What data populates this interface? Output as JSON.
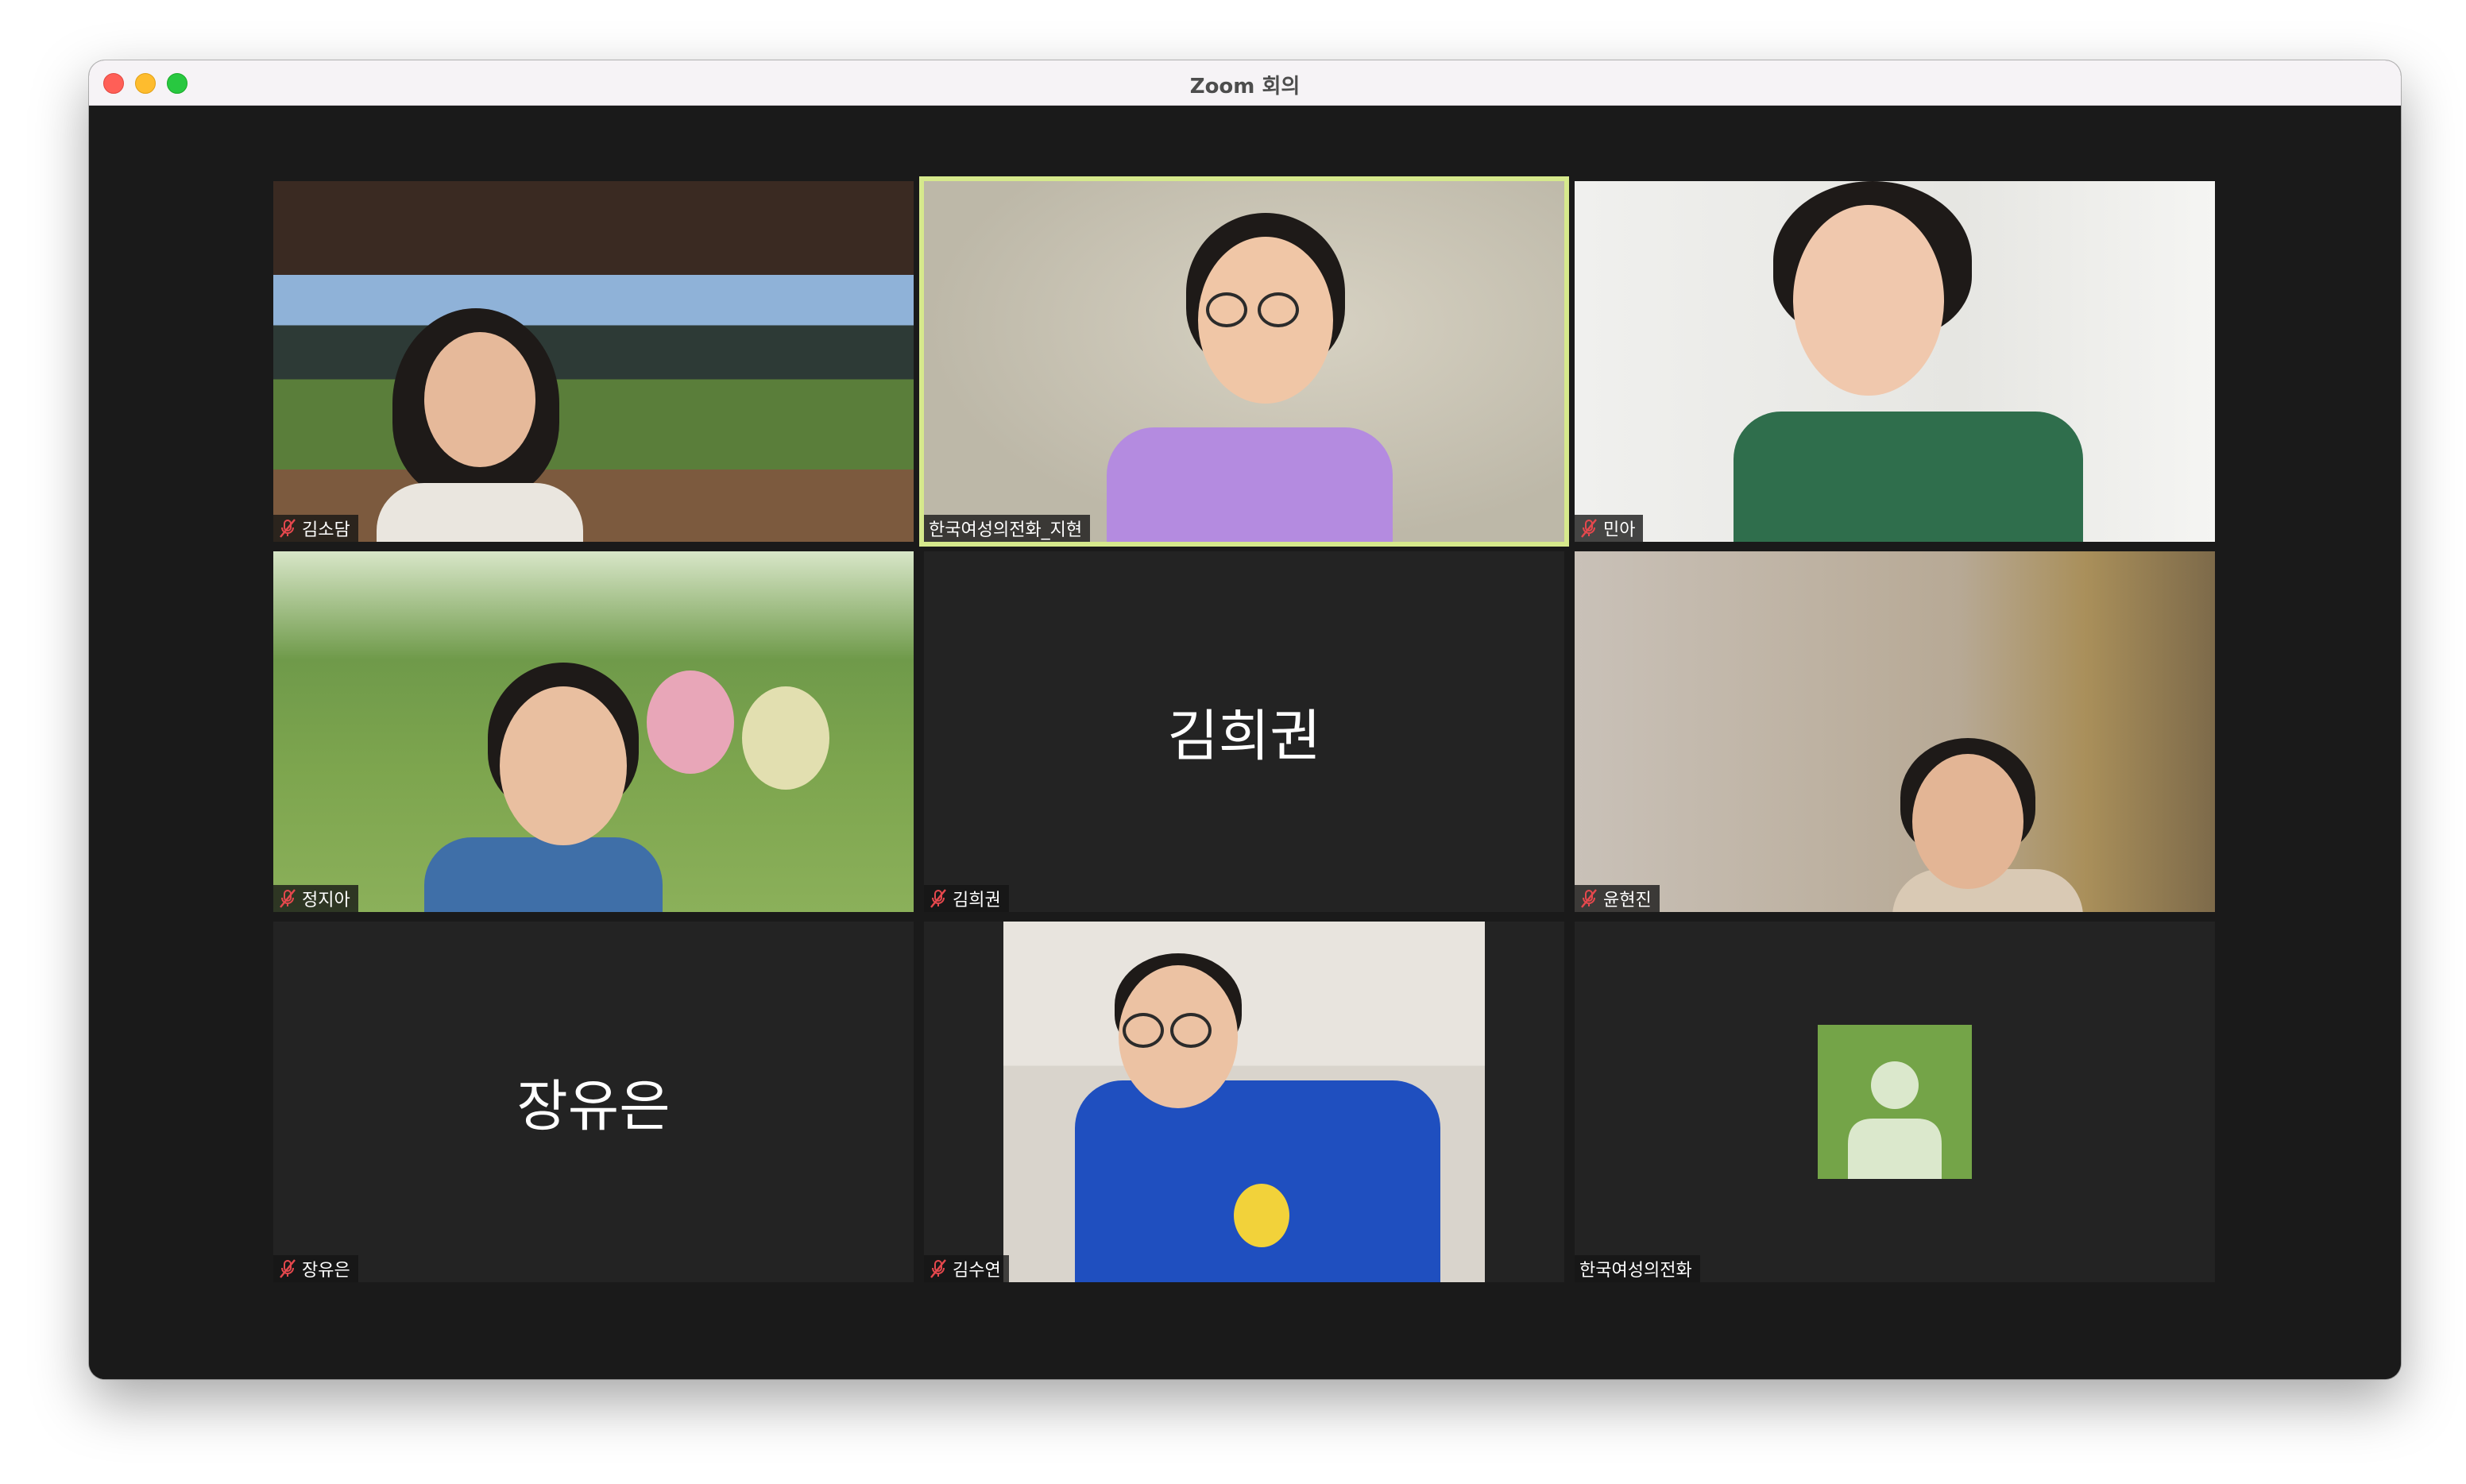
{
  "window": {
    "title": "Zoom 회의",
    "controls": [
      "close",
      "minimize",
      "maximize"
    ]
  },
  "tiles": [
    {
      "name": "김소담",
      "label": "김소담",
      "muted": true,
      "video": true,
      "active": false
    },
    {
      "name": "한국여성의전화_지현",
      "label": "한국여성의전화_지현",
      "muted": false,
      "video": true,
      "active": true
    },
    {
      "name": "민아",
      "label": "민아",
      "muted": true,
      "video": true,
      "active": false
    },
    {
      "name": "정지아",
      "label": "정지아",
      "muted": true,
      "video": true,
      "active": false
    },
    {
      "name": "김희권",
      "label": "김희권",
      "muted": true,
      "video": false,
      "active": false,
      "display_name": "김희권"
    },
    {
      "name": "윤현진",
      "label": "윤현진",
      "muted": true,
      "video": true,
      "active": false
    },
    {
      "name": "장유은",
      "label": "장유은",
      "muted": true,
      "video": false,
      "active": false,
      "display_name": "장유은"
    },
    {
      "name": "김수연",
      "label": "김수연",
      "muted": true,
      "video": true,
      "active": false
    },
    {
      "name": "한국여성의전화",
      "label": "한국여성의전화",
      "muted": false,
      "video": false,
      "active": false,
      "avatar": "default-user-avatar"
    }
  ],
  "colors": {
    "active_speaker_border": "#d6e98c",
    "muted_mic": "#e5484d",
    "avatar_bg": "#74a448",
    "stage_bg": "#1a1a1a"
  }
}
